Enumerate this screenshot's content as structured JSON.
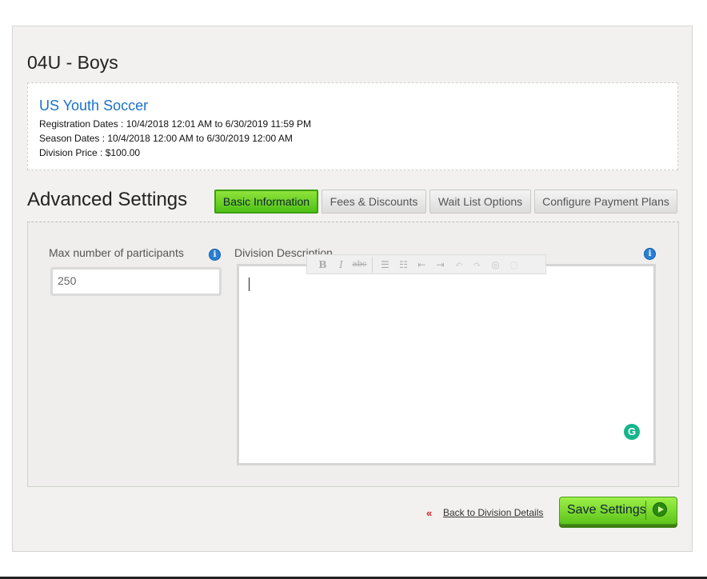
{
  "division": {
    "title": "04U - Boys",
    "league_name": "US Youth Soccer",
    "registration_dates": "Registration Dates : 10/4/2018 12:01 AM to 6/30/2019 11:59 PM",
    "season_dates": "Season Dates : 10/4/2018 12:00 AM to 6/30/2019 12:00 AM",
    "division_price": "Division Price : $100.00"
  },
  "advanced": {
    "title": "Advanced Settings",
    "tabs": [
      {
        "label": "Basic Information",
        "active": true
      },
      {
        "label": "Fees & Discounts",
        "active": false
      },
      {
        "label": "Wait List Options",
        "active": false
      },
      {
        "label": "Configure Payment Plans",
        "active": false
      }
    ]
  },
  "form": {
    "max_participants_label": "Max number of participants",
    "max_participants_value": "250",
    "description_label": "Division Description",
    "description_value": "",
    "info_icon_glyph": "i",
    "toolbar_icons": [
      "bold-icon",
      "italic-icon",
      "strikethrough-icon",
      "ordered-list-icon",
      "unordered-list-icon",
      "outdent-icon",
      "indent-icon",
      "undo-icon",
      "redo-icon",
      "link-icon",
      "unlink-icon"
    ],
    "grammarly_glyph": "G"
  },
  "footer": {
    "back_arrow": "«",
    "back_link": "Back to Division Details",
    "save_label": "Save Settings"
  },
  "colors": {
    "link": "#1a72c9",
    "active_tab": "#5cc41a",
    "save_button": "#6fd02a",
    "info_icon": "#2a7fd6",
    "grammarly": "#15b58a"
  }
}
